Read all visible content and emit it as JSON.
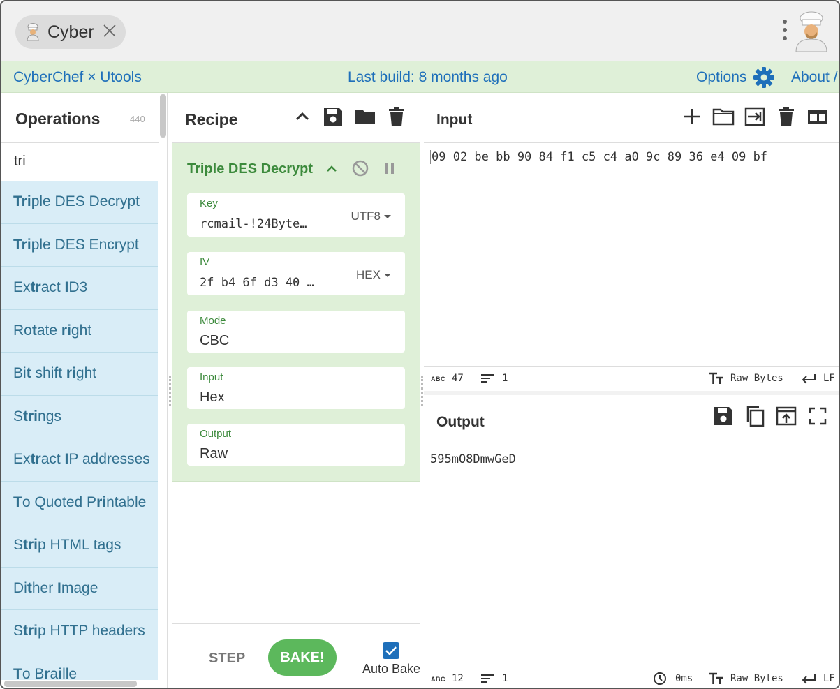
{
  "titlebar": {
    "tab_title": "Cyber"
  },
  "banner": {
    "app_name": "CyberChef × Utools",
    "build": "Last build: 8 months ago",
    "options": "Options",
    "about": "About /"
  },
  "operations": {
    "title": "Operations",
    "count": "440",
    "search_value": "tri",
    "items": [
      {
        "parts": [
          [
            "b",
            "Tri"
          ],
          [
            "n",
            "ple DES Decrypt"
          ]
        ]
      },
      {
        "parts": [
          [
            "b",
            "Tri"
          ],
          [
            "n",
            "ple DES Encrypt"
          ]
        ]
      },
      {
        "parts": [
          [
            "n",
            "Ex"
          ],
          [
            "b",
            "tr"
          ],
          [
            "n",
            "act "
          ],
          [
            "b",
            "I"
          ],
          [
            "n",
            "D3"
          ]
        ]
      },
      {
        "parts": [
          [
            "n",
            "Ro"
          ],
          [
            "b",
            "t"
          ],
          [
            "n",
            "ate "
          ],
          [
            "b",
            "ri"
          ],
          [
            "n",
            "ght"
          ]
        ]
      },
      {
        "parts": [
          [
            "n",
            "Bi"
          ],
          [
            "b",
            "t"
          ],
          [
            "n",
            " shift "
          ],
          [
            "b",
            "ri"
          ],
          [
            "n",
            "ght"
          ]
        ]
      },
      {
        "parts": [
          [
            "n",
            "S"
          ],
          [
            "b",
            "tri"
          ],
          [
            "n",
            "ngs"
          ]
        ]
      },
      {
        "parts": [
          [
            "n",
            "Ex"
          ],
          [
            "b",
            "tr"
          ],
          [
            "n",
            "act "
          ],
          [
            "b",
            "I"
          ],
          [
            "n",
            "P addresses"
          ]
        ]
      },
      {
        "parts": [
          [
            "b",
            "T"
          ],
          [
            "n",
            "o Quoted P"
          ],
          [
            "b",
            "ri"
          ],
          [
            "n",
            "ntable"
          ]
        ]
      },
      {
        "parts": [
          [
            "n",
            "S"
          ],
          [
            "b",
            "tri"
          ],
          [
            "n",
            "p HTML tags"
          ]
        ]
      },
      {
        "parts": [
          [
            "n",
            "Di"
          ],
          [
            "b",
            "t"
          ],
          [
            "n",
            "her "
          ],
          [
            "b",
            "I"
          ],
          [
            "n",
            "mage"
          ]
        ]
      },
      {
        "parts": [
          [
            "n",
            "S"
          ],
          [
            "b",
            "tri"
          ],
          [
            "n",
            "p HTTP headers"
          ]
        ]
      },
      {
        "parts": [
          [
            "b",
            "T"
          ],
          [
            "n",
            "o B"
          ],
          [
            "b",
            "r"
          ],
          [
            "n",
            "a"
          ],
          [
            "b",
            "i"
          ],
          [
            "n",
            "lle"
          ]
        ]
      }
    ]
  },
  "recipe": {
    "title": "Recipe",
    "operation": {
      "name": "Triple DES Decrypt",
      "fields": {
        "key": {
          "label": "Key",
          "value": "rcmail-!24Byte…",
          "encoding": "UTF8"
        },
        "iv": {
          "label": "IV",
          "value": "2f b4 6f d3 40 …",
          "encoding": "HEX"
        },
        "mode": {
          "label": "Mode",
          "value": "CBC"
        },
        "input": {
          "label": "Input",
          "value": "Hex"
        },
        "output": {
          "label": "Output",
          "value": "Raw"
        }
      }
    },
    "step_label": "STEP",
    "bake_label": "BAKE!",
    "autobake_label": "Auto Bake",
    "autobake_checked": true
  },
  "input": {
    "title": "Input",
    "value": "09 02 be bb 90 84 f1 c5 c4 a0 9c 89 36 e4 09 bf",
    "status": {
      "abc": "ABC",
      "length": "47",
      "lines": "1",
      "encoding": "Raw Bytes",
      "eol": "LF"
    }
  },
  "output": {
    "title": "Output",
    "value": "595mO8DmwGeD",
    "status": {
      "abc": "ABC",
      "length": "12",
      "lines": "1",
      "time": "0ms",
      "encoding": "Raw Bytes",
      "eol": "LF"
    }
  },
  "colors": {
    "accent": "#1e6fba",
    "banner_bg": "#dff0d8",
    "recipe_green": "#3c8a3c",
    "op_item_bg": "#d9edf7",
    "bake_green": "#5cb85c"
  }
}
